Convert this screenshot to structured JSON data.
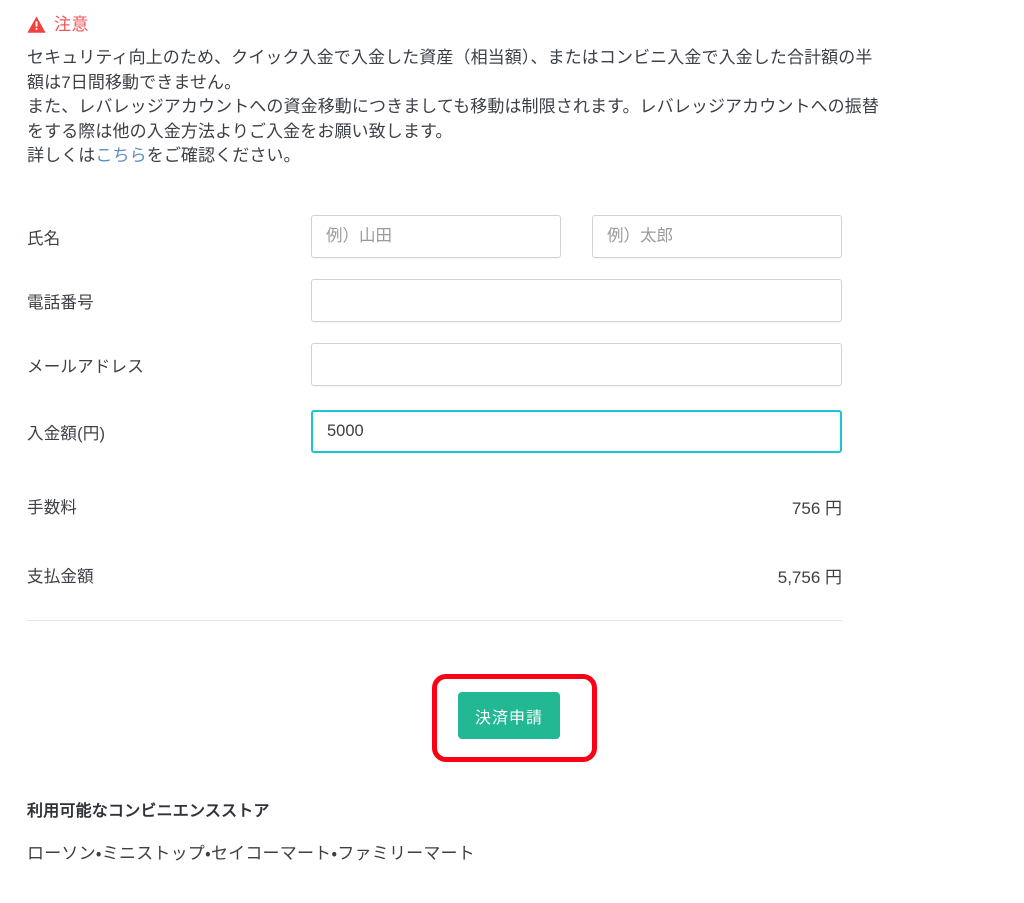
{
  "notice": {
    "icon": "warning-triangle-icon",
    "title": "注意",
    "title_color": "#f2565a",
    "lines": [
      "セキュリティ向上のため、クイック入金で入金した資産（相当額）、またはコンビニ入金で入金した合計額の半",
      "額は7日間移動できません。",
      "また、レバレッジアカウントへの資金移動につきましても移動は制限されます。レバレッジアカウントへの振替",
      "をする際は他の入金方法よりご入金をお願い致します。"
    ],
    "last_line_prefix": "詳しくは",
    "link_text": "こちら",
    "last_line_suffix": "をご確認ください。",
    "link_color": "#5b8ec4"
  },
  "form": {
    "name": {
      "label": "氏名",
      "last_name_value": "",
      "last_name_placeholder": "例）山田",
      "first_name_value": "",
      "first_name_placeholder": "例）太郎"
    },
    "phone": {
      "label": "電話番号",
      "value": "",
      "placeholder": ""
    },
    "email": {
      "label": "メールアドレス",
      "value": "",
      "placeholder": ""
    },
    "amount": {
      "label": "入金額(円)",
      "value": "5000",
      "placeholder": "",
      "focused": true,
      "focus_border_color": "#1ec4d4"
    }
  },
  "summary": {
    "fee": {
      "label": "手数料",
      "value": "756 円"
    },
    "total": {
      "label": "支払金額",
      "value": "5,756 円"
    }
  },
  "submit": {
    "label": "決済申請",
    "button_color": "#22b894",
    "annotation_color": "#fb0116"
  },
  "footer": {
    "heading": "利用可能なコンビニエンスストア",
    "stores": "ローソン・ミニストップ・セイコーマート・ファミリーマート"
  }
}
